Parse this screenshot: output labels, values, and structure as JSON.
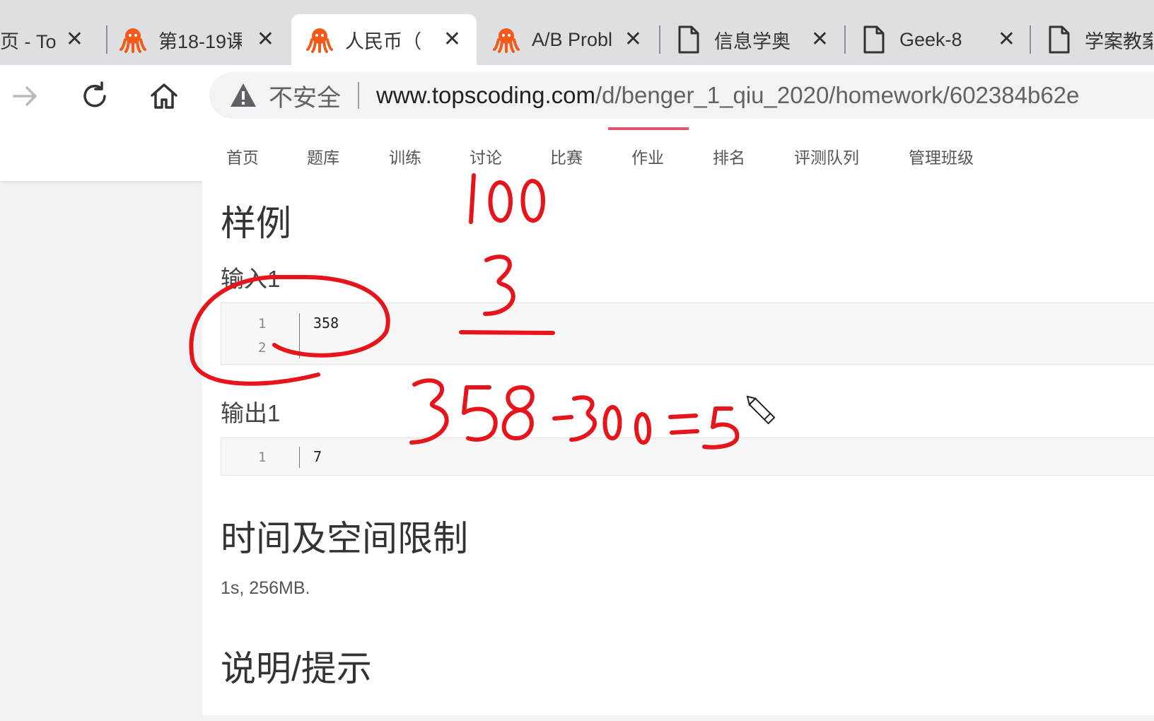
{
  "tabs": [
    {
      "title": "页 - To",
      "icon": "none",
      "close": "✕"
    },
    {
      "title": "第18-19课",
      "icon": "octopus-icon",
      "close": "✕"
    },
    {
      "title": "人民币（",
      "icon": "octopus-icon",
      "close": "✕"
    },
    {
      "title": "A/B Probl",
      "icon": "octopus-icon",
      "close": "✕"
    },
    {
      "title": "信息学奥",
      "icon": "document-icon",
      "close": "✕"
    },
    {
      "title": "Geek-8",
      "icon": "document-icon",
      "close": "✕"
    },
    {
      "title": "学案教案",
      "icon": "document-icon",
      "close": ""
    }
  ],
  "toolbar": {
    "forward_icon": "forward-arrow-icon",
    "reload_icon": "reload-icon",
    "home_icon": "home-icon"
  },
  "omnibox": {
    "security_label": "不安全",
    "url_host": "www.topscoding.com",
    "url_path": "/d/benger_1_qiu_2020/homework/602384b62e"
  },
  "nav": {
    "items": [
      "首页",
      "题库",
      "训练",
      "讨论",
      "比赛",
      "作业",
      "排名",
      "评测队列",
      "管理班级"
    ],
    "active": "作业"
  },
  "content": {
    "sample_heading": "样例",
    "input_label": "输入1",
    "input_lines": [
      {
        "no": "1",
        "text": "358"
      },
      {
        "no": "2",
        "text": ""
      }
    ],
    "output_label": "输出1",
    "output_lines": [
      {
        "no": "1",
        "text": "7"
      }
    ],
    "limits_heading": "时间及空间限制",
    "limits_text": "1s, 256MB.",
    "hint_heading": "说明/提示"
  },
  "annotation": {
    "color": "#e8141b",
    "lines": [
      "100",
      "3",
      "358-300=5"
    ],
    "cursor_icon": "pencil-cursor-icon"
  }
}
